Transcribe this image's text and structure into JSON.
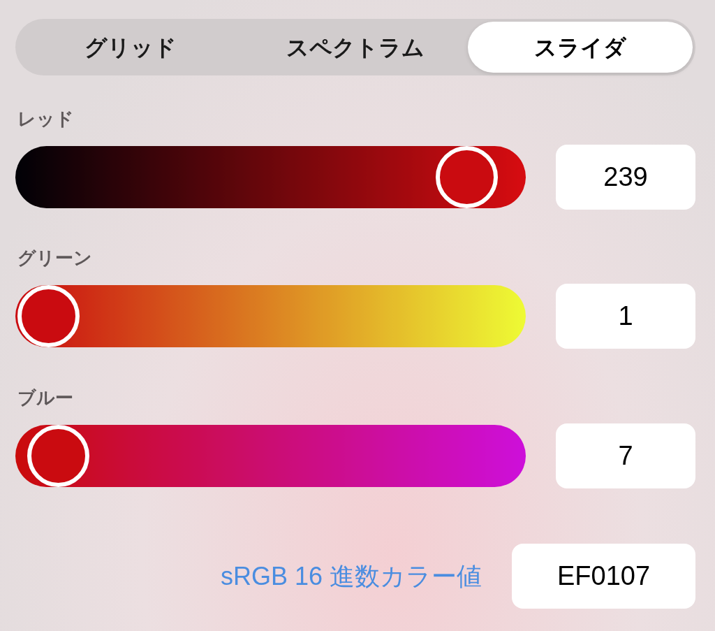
{
  "tabs": [
    {
      "label": "グリッド",
      "selected": false
    },
    {
      "label": "スペクトラム",
      "selected": false
    },
    {
      "label": "スライダ",
      "selected": true
    }
  ],
  "sliders": [
    {
      "label": "レッド",
      "level": 0.937,
      "value": "239"
    },
    {
      "label": "グリーン",
      "level": 0.004,
      "value": "1"
    },
    {
      "label": "ブルー",
      "level": 0.027,
      "value": "7"
    }
  ],
  "hex": {
    "label": "sRGB 16 進数カラー値",
    "value": "EF0107"
  }
}
